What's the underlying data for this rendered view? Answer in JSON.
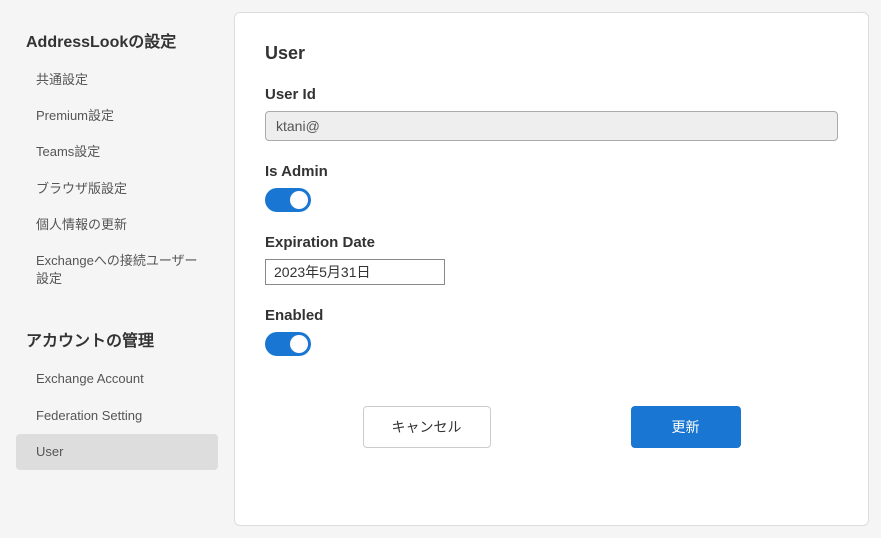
{
  "sidebar": {
    "section1": {
      "title": "AddressLookの設定",
      "items": [
        {
          "label": "共通設定"
        },
        {
          "label": "Premium設定"
        },
        {
          "label": "Teams設定"
        },
        {
          "label": "ブラウザ版設定"
        },
        {
          "label": "個人情報の更新"
        },
        {
          "label": "Exchangeへの接続ユーザー設定"
        }
      ]
    },
    "section2": {
      "title": "アカウントの管理",
      "items": [
        {
          "label": "Exchange Account"
        },
        {
          "label": "Federation Setting"
        },
        {
          "label": "User"
        }
      ]
    }
  },
  "panel": {
    "title": "User",
    "user_id": {
      "label": "User Id",
      "value": "ktani@"
    },
    "is_admin": {
      "label": "Is Admin",
      "value": true
    },
    "expiration_date": {
      "label": "Expiration Date",
      "value": "2023年5月31日"
    },
    "enabled": {
      "label": "Enabled",
      "value": true
    },
    "buttons": {
      "cancel": "キャンセル",
      "submit": "更新"
    }
  }
}
